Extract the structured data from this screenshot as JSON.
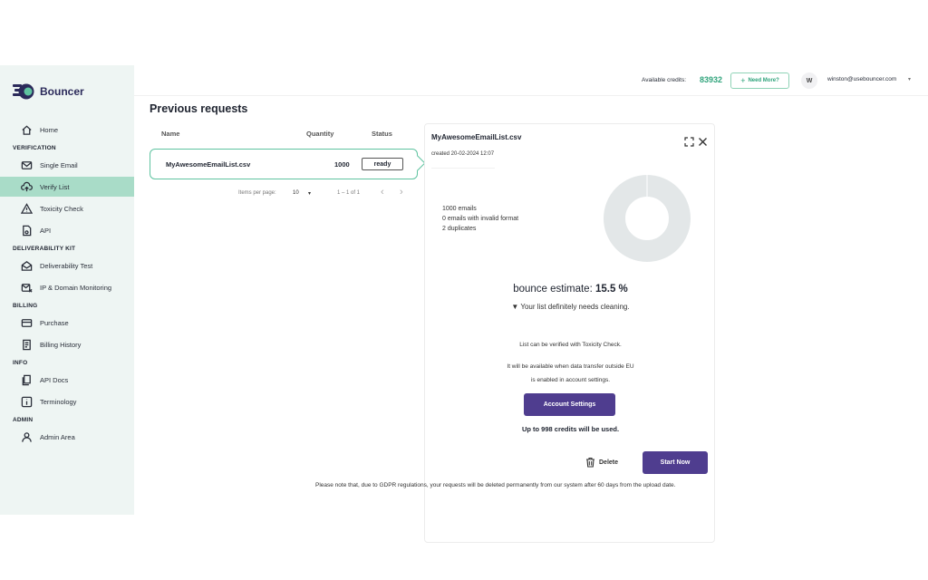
{
  "brand": {
    "name": "Bouncer",
    "accent": "#2fa37b",
    "purple": "#4f3d8f",
    "active_bg": "#a9dcc8"
  },
  "topbar": {
    "credits_label": "Available credits:",
    "credits_value": "83932",
    "need_more": "Need More?",
    "avatar_letter": "W",
    "user_email": "winston@usebouncer.com"
  },
  "sidebar": {
    "home": "Home",
    "sections": {
      "verification": "VERIFICATION",
      "deliverability": "DELIVERABILITY KIT",
      "billing": "BILLING",
      "info": "INFO",
      "admin": "ADMIN"
    },
    "items": {
      "single_email": "Single Email",
      "verify_list": "Verify List",
      "toxicity_check": "Toxicity Check",
      "api": "API",
      "deliverability_test": "Deliverability Test",
      "ip_domain": "IP & Domain Monitoring",
      "purchase": "Purchase",
      "billing_history": "Billing History",
      "api_docs": "API Docs",
      "terminology": "Terminology",
      "admin_area": "Admin Area"
    }
  },
  "main": {
    "title": "Previous requests",
    "columns": {
      "name": "Name",
      "quantity": "Quantity",
      "status": "Status"
    },
    "rows": [
      {
        "name": "MyAwesomeEmailList.csv",
        "quantity": "1000",
        "status": "ready"
      }
    ],
    "pager": {
      "items_label": "Items per page:",
      "per_page": "10",
      "range": "1 – 1 of 1"
    },
    "gdpr_note": "Please note that, due to GDPR regulations, your requests will be deleted permanently from our system after 60 days from the upload date."
  },
  "panel": {
    "filename": "MyAwesomeEmailList.csv",
    "created": "created 20-02-2024 12:07",
    "stats": [
      "1000 emails",
      "0 emails with invalid format",
      "2 duplicates"
    ],
    "bounce_label": "bounce estimate:",
    "bounce_value": "15.5 %",
    "needs_cleaning": "Your list definitely needs cleaning.",
    "toxicity_note": "List can be verified with Toxicity Check.",
    "availability_line1": "It will be available when data transfer outside EU",
    "availability_line2": "is enabled in account settings.",
    "account_settings": "Account Settings",
    "credits_used": "Up to 998 credits will be used.",
    "delete": "Delete",
    "start_now": "Start Now"
  }
}
